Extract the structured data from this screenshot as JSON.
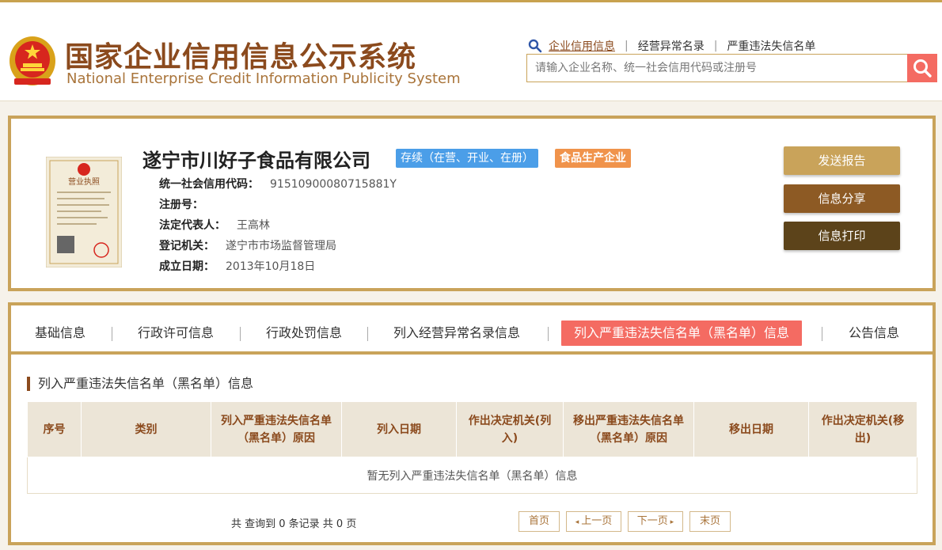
{
  "header": {
    "title_cn": "国家企业信用信息公示系统",
    "title_en": "National Enterprise Credit Information Publicity System",
    "search_links": [
      "企业信用信息",
      "经营异常名录",
      "严重违法失信名单"
    ],
    "search_placeholder": "请输入企业名称、统一社会信用代码或注册号",
    "icons": {
      "emblem": "national-emblem-icon",
      "magnifier": "search-icon"
    }
  },
  "company": {
    "name": "遂宁市川好子食品有限公司",
    "status_badge": "存续（在营、开业、在册）",
    "type_badge": "食品生产企业",
    "license_image_text": "营业执照",
    "fields": [
      {
        "label": "统一社会信用代码：",
        "value": "91510900080715881Y"
      },
      {
        "label": "注册号：",
        "value": ""
      },
      {
        "label": "法定代表人：",
        "value": "王高林"
      },
      {
        "label": "登记机关：",
        "value": "遂宁市市场监督管理局"
      },
      {
        "label": "成立日期：",
        "value": "2013年10月18日"
      }
    ],
    "buttons": {
      "report": "发送报告",
      "share": "信息分享",
      "print": "信息打印"
    }
  },
  "tabs": [
    "基础信息",
    "行政许可信息",
    "行政处罚信息",
    "列入经营异常名录信息",
    "列入严重违法失信名单（黑名单）信息",
    "公告信息"
  ],
  "active_tab": "列入严重违法失信名单（黑名单）信息",
  "section": {
    "title": "列入严重违法失信名单（黑名单）信息",
    "columns": [
      "序号",
      "类别",
      "列入严重违法失信名单（黑名单）原因",
      "列入日期",
      "作出决定机关(列入)",
      "移出严重违法失信名单（黑名单）原因",
      "移出日期",
      "作出决定机关(移出)"
    ],
    "empty_text": "暂无列入严重违法失信名单（黑名单）信息"
  },
  "pager": {
    "summary": "共 查询到 0 条记录 共 0 页",
    "first": "首页",
    "prev": "上一页",
    "next": "下一页",
    "last": "末页"
  },
  "colors": {
    "brand": "#8b4a1d",
    "gold": "#c9a35a",
    "accent_red": "#f46b62",
    "status_blue": "#4b9ee8",
    "type_orange": "#f0934b"
  }
}
